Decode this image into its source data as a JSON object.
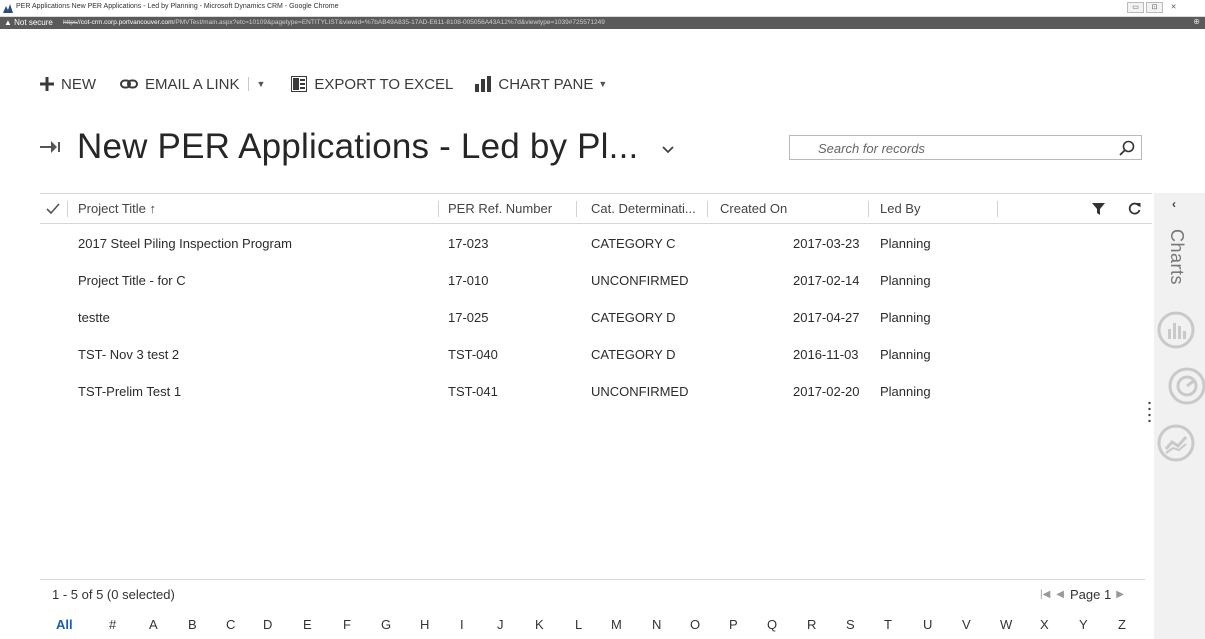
{
  "window": {
    "title": "PER Applications New PER Applications - Led by Planning - Microsoft Dynamics CRM - Google Chrome",
    "controls": [
      "▭",
      "⊡",
      "✕"
    ]
  },
  "address_bar": {
    "security": "Not secure",
    "scheme": "https",
    "host": "//cot-crm.corp.portvancouver.com",
    "path": "/PMVTest/main.aspx?etc=10109&pagetype=ENTITYLIST&viewid=%7bAB49A835-17AD-E611-8108-005056A43A12%7d&viewtype=1039#725571249"
  },
  "commands": {
    "new": "NEW",
    "email_link": "EMAIL A LINK",
    "export_excel": "EXPORT TO EXCEL",
    "chart_pane": "CHART PANE"
  },
  "view": {
    "title": "New PER Applications - Led by Pl..."
  },
  "search": {
    "placeholder": "Search for records"
  },
  "grid": {
    "columns": {
      "project_title": "Project Title ↑",
      "per_ref": "PER Ref. Number",
      "cat": "Cat. Determinati...",
      "created": "Created On",
      "led_by": "Led By"
    },
    "rows": [
      {
        "title": "2017 Steel Piling Inspection Program",
        "ref": "17-023",
        "cat": "CATEGORY C",
        "created": "2017-03-23",
        "led": "Planning"
      },
      {
        "title": "Project Title - for C",
        "ref": "17-010",
        "cat": "UNCONFIRMED",
        "created": "2017-02-14",
        "led": "Planning"
      },
      {
        "title": "testte",
        "ref": "17-025",
        "cat": "CATEGORY D",
        "created": "2017-04-27",
        "led": "Planning"
      },
      {
        "title": "TST- Nov 3 test 2",
        "ref": "TST-040",
        "cat": "CATEGORY D",
        "created": "2016-11-03",
        "led": "Planning"
      },
      {
        "title": "TST-Prelim Test 1",
        "ref": "TST-041",
        "cat": "UNCONFIRMED",
        "created": "2017-02-20",
        "led": "Planning"
      }
    ]
  },
  "side_pane": {
    "collapse": "‹",
    "label": "Charts"
  },
  "footer": {
    "status": "1 - 5 of 5 (0 selected)",
    "page": "Page 1",
    "alphabet": [
      "All",
      "#",
      "A",
      "B",
      "C",
      "D",
      "E",
      "F",
      "G",
      "H",
      "I",
      "J",
      "K",
      "L",
      "M",
      "N",
      "O",
      "P",
      "Q",
      "R",
      "S",
      "T",
      "U",
      "V",
      "W",
      "X",
      "Y",
      "Z"
    ]
  },
  "colors": {
    "accent_link": "#1b5ea8",
    "address_bar_bg": "#5a5a5a",
    "side_pane_bg": "#f1f1f1"
  }
}
